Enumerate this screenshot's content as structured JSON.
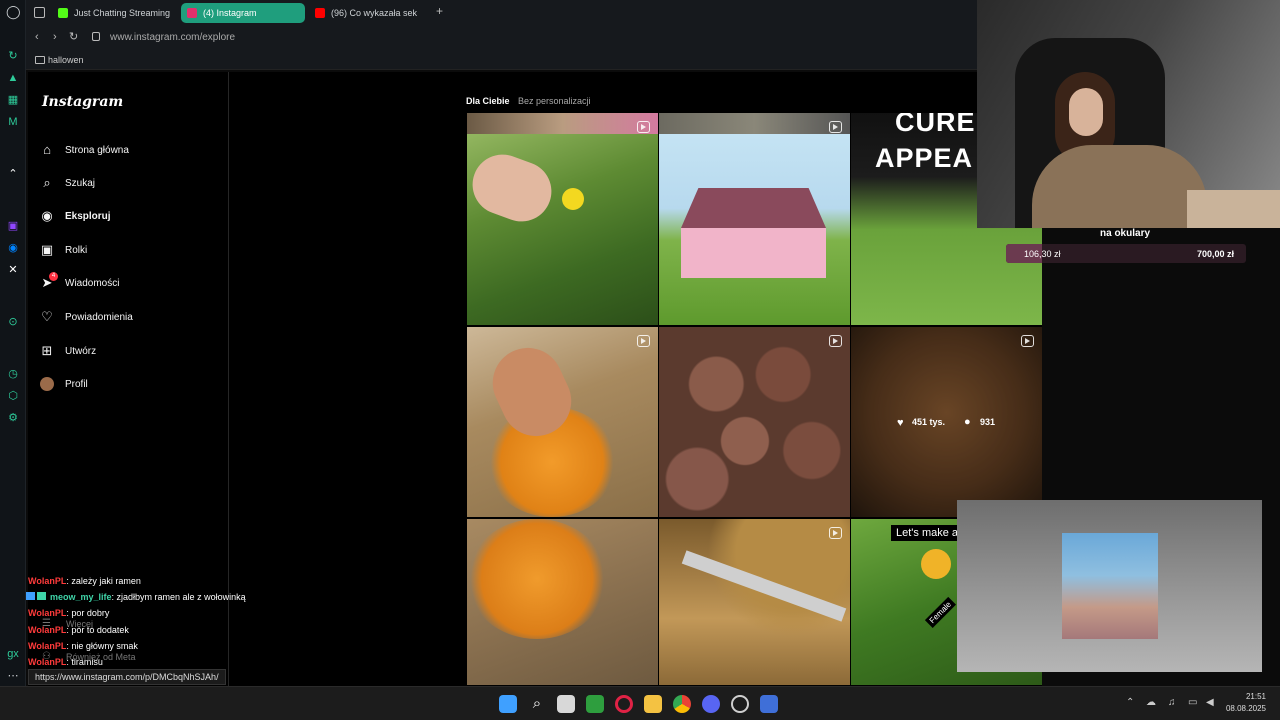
{
  "browser": {
    "tabs": [
      {
        "label": "Just Chatting Streaming",
        "color": "#53fc18"
      },
      {
        "label": "(4) Instagram",
        "color": "#e1306c"
      },
      {
        "label": "(96) Co wykazała sek",
        "color": "#ff0000"
      }
    ],
    "new_tab": "+",
    "url": "www.instagram.com/explore",
    "bookmark": "hallowen"
  },
  "instagram": {
    "logo": "Instagram",
    "nav": [
      {
        "label": "Strona główna",
        "icon": "home-icon"
      },
      {
        "label": "Szukaj",
        "icon": "search-icon"
      },
      {
        "label": "Eksploruj",
        "icon": "explore-icon"
      },
      {
        "label": "Rolki",
        "icon": "reels-icon"
      },
      {
        "label": "Wiadomości",
        "icon": "messages-icon",
        "badge": "4"
      },
      {
        "label": "Powiadomienia",
        "icon": "heart-icon"
      },
      {
        "label": "Utwórz",
        "icon": "create-icon"
      },
      {
        "label": "Profil",
        "icon": "avatar"
      }
    ],
    "more": {
      "label": "Więcej",
      "meta_label": "Również od Meta"
    },
    "explore_tabs": {
      "active": "Dla Ciebie",
      "inactive": "Bez personalizacji"
    },
    "tile_text": {
      "cure": "CURE",
      "appea": "APPEA",
      "lets_make": "Let's make a l",
      "female": "Female"
    },
    "hover_stats": {
      "likes": "451 tys.",
      "comments": "931"
    }
  },
  "overlay": {
    "goal_title": "na okulary",
    "goal_current": "106,30 zł",
    "goal_target": "700,00 zł",
    "goal_progress": 0.152
  },
  "chat": [
    {
      "user": "WolanPL",
      "text": ": zależy jaki ramen"
    },
    {
      "user": "meow_my_life",
      "text": ": zjadłbym ramen ale z wołowinką",
      "user_color": "#3fd4a8"
    },
    {
      "user": "WolanPL",
      "text": ": por dobry"
    },
    {
      "user": "WolanPL",
      "text": ": por to dodatek"
    },
    {
      "user": "WolanPL",
      "text": ": nie główny smak"
    },
    {
      "user": "WolanPL",
      "text": ": tiramisu"
    }
  ],
  "status_url": "https://www.instagram.com/p/DMCbqNhSJAh/",
  "taskbar": {
    "time": "21:51",
    "date": "08.08.2025"
  }
}
